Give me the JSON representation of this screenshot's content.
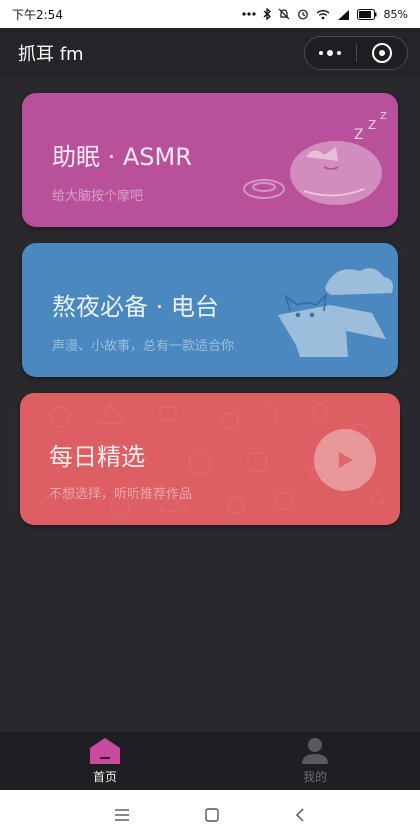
{
  "status_bar": {
    "time": "下午2:54",
    "battery": "85%",
    "icons": [
      "dots-icon",
      "bluetooth-icon",
      "mute-icon",
      "alarm-icon",
      "wifi-icon",
      "signal-icon",
      "battery-icon"
    ]
  },
  "nav_bar": {
    "title": "抓耳 fm"
  },
  "cards": [
    {
      "title": "助眠 · ASMR",
      "subtitle": "给大脑按个摩吧",
      "color": "#b9519a",
      "icon": "sleeping-cat-icon"
    },
    {
      "title": "熬夜必备 · 电台",
      "subtitle": "声漫、小故事，总有一款适合你",
      "color": "#4a88bf",
      "icon": "cat-in-box-icon"
    },
    {
      "title": "每日精选",
      "subtitle": "不想选择，听听推荐作品",
      "color": "#dd5e63",
      "icon": "play-icon"
    }
  ],
  "tab_bar": {
    "tabs": [
      {
        "label": "首页",
        "icon": "home-icon",
        "active": true,
        "accent": "#c94a9e"
      },
      {
        "label": "我的",
        "icon": "user-icon",
        "active": false
      }
    ]
  },
  "system_nav": {
    "icons": [
      "menu-icon",
      "home-square-icon",
      "back-icon"
    ]
  }
}
